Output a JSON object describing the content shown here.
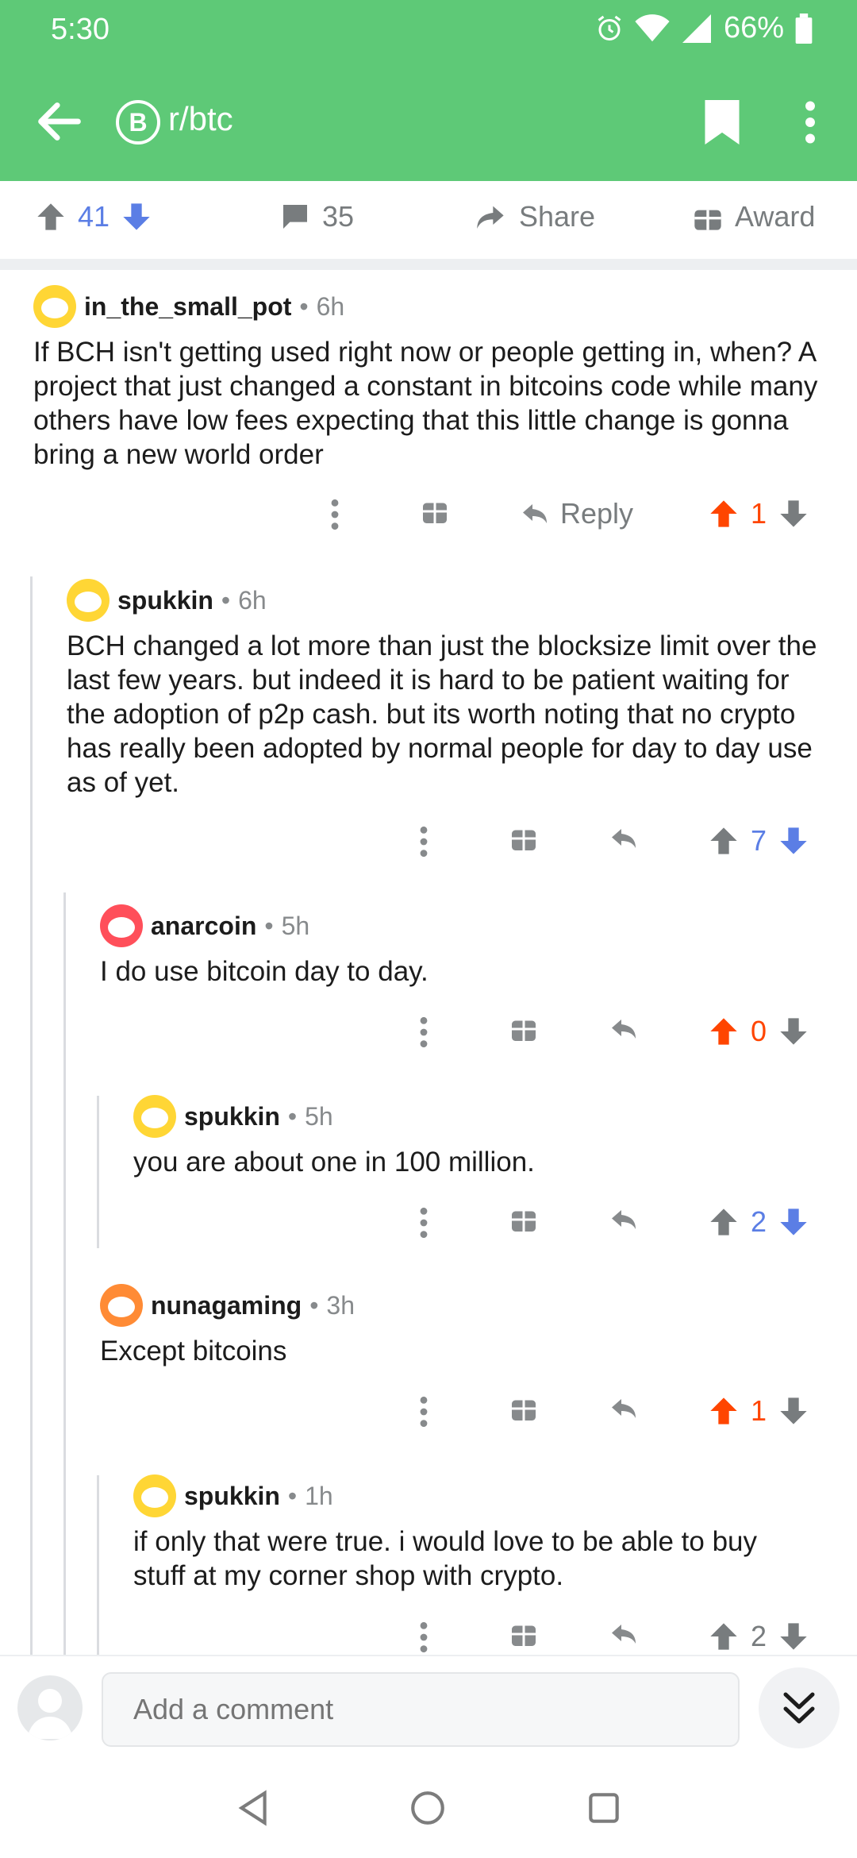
{
  "status": {
    "time": "5:30",
    "battery": "66%"
  },
  "header": {
    "subreddit": "r/btc",
    "sub_icon_glyph": "B"
  },
  "post_actions": {
    "score": "41",
    "comments": "35",
    "share": "Share",
    "award": "Award"
  },
  "comments": [
    {
      "user": "in_the_small_pot",
      "age": "6h",
      "text": "If BCH isn't getting used right now or people getting in, when? A project that just changed a constant in bitcoins code while many others have low fees expecting that this little change is gonna bring a new world order",
      "score": "1",
      "reply": "Reply"
    },
    {
      "user": "spukkin",
      "age": "6h",
      "text": "BCH changed a lot more than just the blocksize limit over the last few years.  but indeed it is hard to be patient waiting for the adoption of p2p cash. but its worth noting that no crypto has really been adopted by normal people for day to day use as of yet.",
      "score": "7"
    },
    {
      "user": "anarcoin",
      "age": "5h",
      "text": "I do use bitcoin day to day.",
      "score": "0"
    },
    {
      "user": "spukkin",
      "age": "5h",
      "text": "you are about one in 100 million.",
      "score": "2"
    },
    {
      "user": "nunagaming",
      "age": "3h",
      "text": "Except bitcoins",
      "score": "1"
    },
    {
      "user": "spukkin",
      "age": "1h",
      "text": "if only that were true. i would love to be able to buy stuff at my corner shop with crypto.",
      "score": "2"
    }
  ],
  "meta_sep": "•",
  "composer": {
    "placeholder": "Add a comment"
  },
  "colors": {
    "brand": "#5ec977",
    "upvote": "#ff4500",
    "downvote": "#7193ff",
    "muted": "#878a8c"
  }
}
